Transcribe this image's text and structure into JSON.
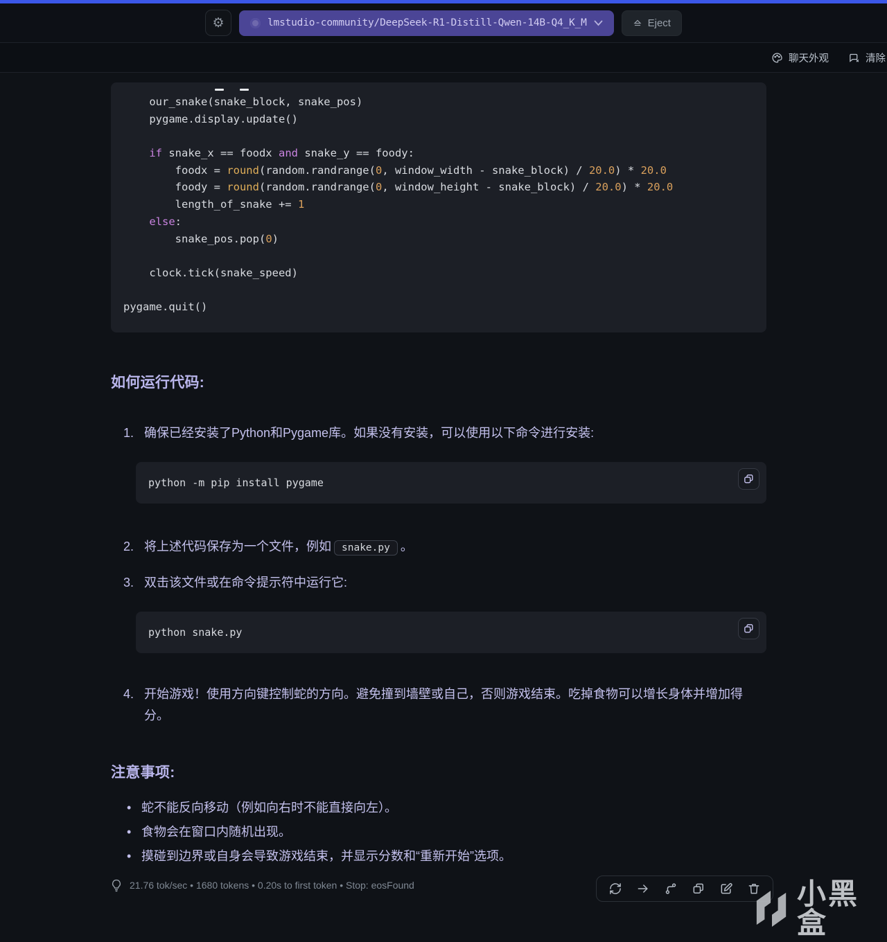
{
  "titlebar": {
    "model_name": "lmstudio-community/DeepSeek-R1-Distill-Qwen-14B-Q4_K_M",
    "eject_label": "Eject"
  },
  "toolbar": {
    "appearance_label": "聊天外观",
    "clear_label": "清除"
  },
  "main_code": {
    "language": "python",
    "lines": [
      [
        [
          "p",
          "    our_snake(snake_block, snake_pos)"
        ]
      ],
      [
        [
          "p",
          "    pygame.display.update()"
        ]
      ],
      [],
      [
        [
          "p",
          "    "
        ],
        [
          "k",
          "if"
        ],
        [
          "p",
          " snake_x == foodx "
        ],
        [
          "k",
          "and"
        ],
        [
          "p",
          " snake_y == foody:"
        ]
      ],
      [
        [
          "p",
          "        foodx = "
        ],
        [
          "f",
          "round"
        ],
        [
          "p",
          "(random.randrange("
        ],
        [
          "n",
          "0"
        ],
        [
          "p",
          ", window_width - snake_block) / "
        ],
        [
          "n",
          "20.0"
        ],
        [
          "p",
          ") * "
        ],
        [
          "n",
          "20.0"
        ]
      ],
      [
        [
          "p",
          "        foody = "
        ],
        [
          "f",
          "round"
        ],
        [
          "p",
          "(random.randrange("
        ],
        [
          "n",
          "0"
        ],
        [
          "p",
          ", window_height - snake_block) / "
        ],
        [
          "n",
          "20.0"
        ],
        [
          "p",
          ") * "
        ],
        [
          "n",
          "20.0"
        ]
      ],
      [
        [
          "p",
          "        length_of_snake += "
        ],
        [
          "n",
          "1"
        ]
      ],
      [
        [
          "p",
          "    "
        ],
        [
          "k",
          "else"
        ],
        [
          "p",
          ":"
        ]
      ],
      [
        [
          "p",
          "        snake_pos.pop("
        ],
        [
          "n",
          "0"
        ],
        [
          "p",
          ")"
        ]
      ],
      [],
      [
        [
          "p",
          "    clock.tick(snake_speed)"
        ]
      ],
      [],
      [
        [
          "p",
          "pygame.quit()"
        ]
      ]
    ]
  },
  "sections": {
    "how_to_run_heading": "如何运行代码:",
    "steps": [
      {
        "num": "1.",
        "text": "确保已经安装了Python和Pygame库。如果没有安装，可以使用以下命令进行安装:"
      },
      {
        "num": "2.",
        "text_before": "将上述代码保存为一个文件，例如",
        "inline_code": "snake.py",
        "text_after": "。"
      },
      {
        "num": "3.",
        "text": "双击该文件或在命令提示符中运行它:"
      },
      {
        "num": "4.",
        "text": "开始游戏！使用方向键控制蛇的方向。避免撞到墙壁或自己，否则游戏结束。吃掉食物可以增长身体并增加得分。"
      }
    ],
    "pip_command": "python -m pip install pygame",
    "run_command": "python snake.py",
    "notes_heading": "注意事项:",
    "notes_bullets": [
      "蛇不能反向移动（例如向右时不能直接向左）。",
      "食物会在窗口内随机出现。",
      "摸碰到边界或自身会导致游戏结束，并显示分数和“重新开始”选项。"
    ]
  },
  "statusbar": {
    "text": "21.76 tok/sec • 1680 tokens • 0.20s to first token • Stop: eosFound"
  },
  "watermark": {
    "text": "小黑盒"
  },
  "colors": {
    "top_accent": "#3b57e8",
    "model_pill_bg": "#4b4596",
    "code_bg": "#1c1f26",
    "keyword": "#c983e0",
    "function": "#e0ae59",
    "number": "#d9a05c",
    "body_text": "#c3c0ec",
    "status_text": "#7f8893"
  }
}
